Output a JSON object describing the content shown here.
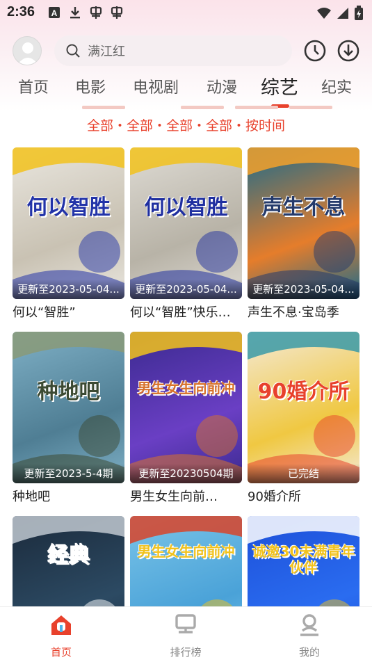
{
  "status_bar": {
    "time": "2:36"
  },
  "header": {
    "search_placeholder": "满江红"
  },
  "tabs": [
    {
      "label": "首页",
      "active": false
    },
    {
      "label": "电影",
      "active": false
    },
    {
      "label": "电视剧",
      "active": false
    },
    {
      "label": "动漫",
      "active": false
    },
    {
      "label": "综艺",
      "active": true
    },
    {
      "label": "纪实",
      "active": false
    }
  ],
  "filter": {
    "text": "全部・全部・全部・全部・按时间"
  },
  "cards": [
    {
      "title": "何以“智胜”",
      "badge": "更新至2023-05-04...",
      "poster_text": "何以智胜",
      "colors": [
        "#e9e6df",
        "#c9c2b3",
        "#2233a8",
        "#f2c21c"
      ]
    },
    {
      "title": "何以“智胜”快乐…",
      "badge": "更新至2023-05-04...",
      "poster_text": "何以智胜",
      "colors": [
        "#dedbd4",
        "#b8b3a7",
        "#1f2fa0",
        "#f2c21c"
      ]
    },
    {
      "title": "声生不息·宝岛季",
      "badge": "更新至2023-05-04...",
      "poster_text": "声生不息",
      "colors": [
        "#1a6b8c",
        "#e57d2b",
        "#243a6b",
        "#f5a12a"
      ]
    },
    {
      "title": "种地吧",
      "badge": "更新至2023-5-4期",
      "poster_text": "种地吧",
      "colors": [
        "#7fb0c6",
        "#4f7e94",
        "#3c4a33",
        "#8a9a78"
      ]
    },
    {
      "title": "男生女生向前…",
      "badge": "更新至20230504期",
      "poster_text": "男生女生向前冲",
      "colors": [
        "#3b2a8f",
        "#6a3fc4",
        "#d8722a",
        "#f2c21c"
      ]
    },
    {
      "title": "90婚介所",
      "badge": "已完结",
      "poster_text": "90婚介所",
      "colors": [
        "#f4e9d6",
        "#f0c842",
        "#e8412c",
        "#3a9aa7"
      ]
    },
    {
      "title": "",
      "badge": "",
      "poster_text": "经典",
      "colors": [
        "#1b2a3b",
        "#2c4a63",
        "#ffffff",
        "#c0c8d0"
      ]
    },
    {
      "title": "",
      "badge": "",
      "poster_text": "男生女生向前冲",
      "colors": [
        "#7ac4e8",
        "#4aa2d8",
        "#f2c21c",
        "#d8442a"
      ]
    },
    {
      "title": "",
      "badge": "",
      "poster_text": "诚邀30未满青年伙伴",
      "colors": [
        "#1d4fd8",
        "#2a6cf0",
        "#f2c21c",
        "#ffffff"
      ]
    }
  ],
  "bottom_nav": [
    {
      "label": "首页",
      "icon": "home-icon",
      "active": true
    },
    {
      "label": "排行榜",
      "icon": "ranking-icon",
      "active": false
    },
    {
      "label": "我的",
      "icon": "profile-icon",
      "active": false
    }
  ],
  "theme": {
    "accent": "#e8412c"
  }
}
